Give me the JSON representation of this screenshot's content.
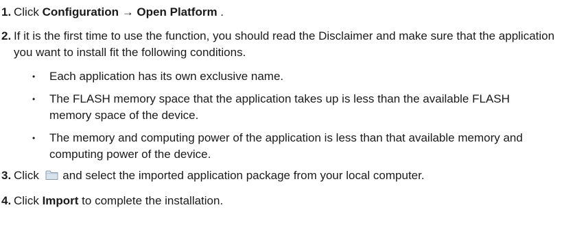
{
  "steps": [
    {
      "number": "1.",
      "prefix": "Click ",
      "bold": "Configuration → Open Platform",
      "suffix": " ."
    },
    {
      "number": "2.",
      "text": "If it is the first time to use the function, you should read the Disclaimer and make sure that the application you want to install fit the following conditions.",
      "bullets": [
        "Each application has its own exclusive name.",
        "The FLASH memory space that the application takes up is less than the available FLASH memory space of the device.",
        "The memory and computing power of the application is less than that available memory and computing power of the device."
      ]
    },
    {
      "number": "3.",
      "prefix": "Click ",
      "icon": "folder-icon",
      "suffix": " and select the imported application package from your local computer."
    },
    {
      "number": "4.",
      "prefix": "Click ",
      "bold": "Import",
      "suffix": " to complete the installation."
    }
  ],
  "bullet_glyph": "•",
  "colors": {
    "text": "#1a1a1a",
    "folder_fill": "#d9e3ee",
    "folder_stroke": "#8a9bb0"
  }
}
